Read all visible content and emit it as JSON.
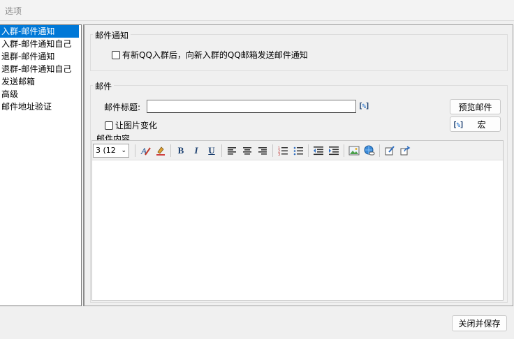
{
  "window": {
    "title": "选项"
  },
  "nav": {
    "items": [
      {
        "label": "入群-邮件通知",
        "selected": true
      },
      {
        "label": "入群-邮件通知自己",
        "selected": false
      },
      {
        "label": "退群-邮件通知",
        "selected": false
      },
      {
        "label": "退群-邮件通知自己",
        "selected": false
      },
      {
        "label": "发送邮箱",
        "selected": false
      },
      {
        "label": "高级",
        "selected": false
      },
      {
        "label": "邮件地址验证",
        "selected": false
      }
    ]
  },
  "notify_group": {
    "label": "邮件通知",
    "checkbox_label": "有新QQ入群后，向新入群的QQ邮箱发送邮件通知",
    "checked": false
  },
  "mail_group": {
    "label": "邮件",
    "subject_label": "邮件标题:",
    "subject_value": "",
    "preview_button": "预览邮件",
    "image_change_label": "让图片变化",
    "image_change_checked": false,
    "macro_button": "宏",
    "content_label": "邮件内容"
  },
  "toolbar": {
    "font_size_value": "3 (12",
    "icons": [
      "font-color-icon",
      "highlight-color-icon",
      "bold-icon",
      "italic-icon",
      "underline-icon",
      "align-left-icon",
      "align-center-icon",
      "align-right-icon",
      "numbered-list-icon",
      "bullet-list-icon",
      "outdent-icon",
      "indent-icon",
      "insert-image-icon",
      "insert-link-icon",
      "edit-source-icon",
      "export-icon"
    ]
  },
  "footer": {
    "close_save_button": "关闭并保存"
  }
}
